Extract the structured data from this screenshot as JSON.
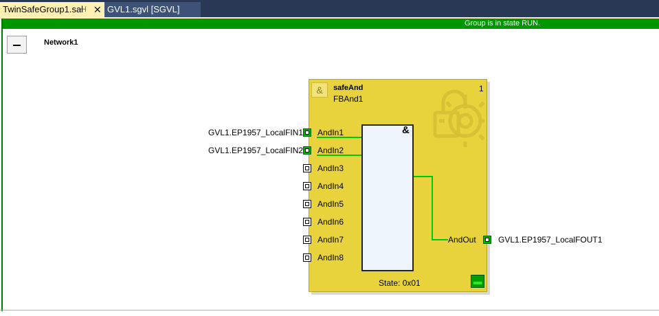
{
  "tabs": [
    {
      "label": "TwinSafeGroup1.sal",
      "pin_icon": "⊣",
      "close_icon": "✕"
    },
    {
      "label": "GVL1.sgvl [SGVL]"
    }
  ],
  "status": {
    "text": "Group is in state RUN."
  },
  "network": {
    "label": "Network1"
  },
  "function_block": {
    "type": "safeAnd",
    "instance": "FBAnd1",
    "number": "1",
    "operator": "&",
    "inputs": [
      {
        "name": "AndIn1",
        "variable": "GVL1.EP1957_LocalFIN1",
        "connected": true
      },
      {
        "name": "AndIn2",
        "variable": "GVL1.EP1957_LocalFIN2",
        "connected": true
      },
      {
        "name": "AndIn3",
        "variable": "",
        "connected": false
      },
      {
        "name": "AndIn4",
        "variable": "",
        "connected": false
      },
      {
        "name": "AndIn5",
        "variable": "",
        "connected": false
      },
      {
        "name": "AndIn6",
        "variable": "",
        "connected": false
      },
      {
        "name": "AndIn7",
        "variable": "",
        "connected": false
      },
      {
        "name": "AndIn8",
        "variable": "",
        "connected": false
      }
    ],
    "output": {
      "name": "AndOut",
      "variable": "GVL1.EP1957_LocalFOUT1",
      "connected": true
    },
    "state": "State: 0x01"
  },
  "colors": {
    "status_green": "#009600",
    "fb_yellow": "#e8d33d",
    "wire_green": "#00c800",
    "tab_active": "#fff1b3",
    "tab_strip": "#293955"
  }
}
